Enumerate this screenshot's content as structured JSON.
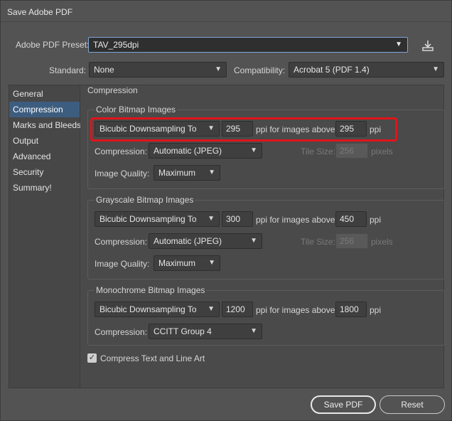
{
  "window": {
    "title": "Save Adobe PDF"
  },
  "preset": {
    "label": "Adobe PDF Preset:",
    "value": "TAV_295dpi"
  },
  "standard": {
    "label": "Standard:",
    "value": "None"
  },
  "compatibility": {
    "label": "Compatibility:",
    "value": "Acrobat 5 (PDF 1.4)"
  },
  "sidebar": {
    "items": [
      {
        "label": "General"
      },
      {
        "label": "Compression"
      },
      {
        "label": "Marks and Bleeds"
      },
      {
        "label": "Output"
      },
      {
        "label": "Advanced"
      },
      {
        "label": "Security"
      },
      {
        "label": "Summary!"
      }
    ],
    "selected": "Compression"
  },
  "section_title": "Compression",
  "color": {
    "title": "Color Bitmap Images",
    "method": "Bicubic Downsampling To",
    "ppi": "295",
    "ppi_label": "ppi for images above",
    "above": "295",
    "unit": "ppi",
    "compression_label": "Compression:",
    "compression": "Automatic (JPEG)",
    "tile_label": "Tile Size:",
    "tile": "256",
    "tile_unit": "pixels",
    "quality_label": "Image Quality:",
    "quality": "Maximum"
  },
  "gray": {
    "title": "Grayscale Bitmap Images",
    "method": "Bicubic Downsampling To",
    "ppi": "300",
    "ppi_label": "ppi for images above",
    "above": "450",
    "unit": "ppi",
    "compression_label": "Compression:",
    "compression": "Automatic (JPEG)",
    "tile_label": "Tile Size:",
    "tile": "256",
    "tile_unit": "pixels",
    "quality_label": "Image Quality:",
    "quality": "Maximum"
  },
  "mono": {
    "title": "Monochrome Bitmap Images",
    "method": "Bicubic Downsampling To",
    "ppi": "1200",
    "ppi_label": "ppi for images above",
    "above": "1800",
    "unit": "ppi",
    "compression_label": "Compression:",
    "compression": "CCITT Group 4"
  },
  "compress_text": {
    "label": "Compress Text and Line Art",
    "checked": true
  },
  "buttons": {
    "save": "Save PDF",
    "reset": "Reset"
  },
  "icons": {
    "dropdown": "chevron-down-icon",
    "save_preset": "download-icon",
    "checkbox": "checkmark-icon"
  },
  "colors": {
    "highlight": "#e0141a",
    "selection": "#3d5d7f"
  }
}
